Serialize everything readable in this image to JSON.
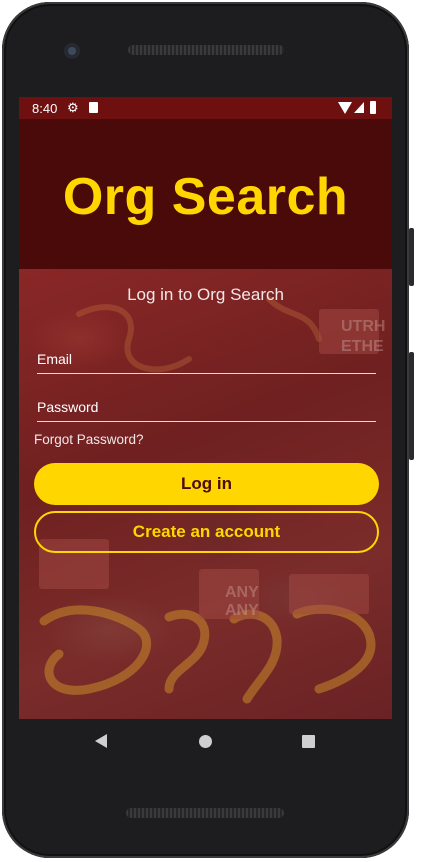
{
  "status_bar": {
    "time": "8:40",
    "icons": [
      "gear-icon",
      "sd-card-icon",
      "wifi-icon",
      "signal-icon",
      "battery-icon"
    ]
  },
  "app": {
    "title": "Org Search",
    "subtitle": "Log in to Org Search"
  },
  "form": {
    "email_placeholder": "Email",
    "password_placeholder": "Password",
    "forgot_label": "Forgot Password?",
    "login_label": "Log in",
    "create_label": "Create an account"
  },
  "nav": {
    "icons": [
      "back-icon",
      "home-icon",
      "recents-icon"
    ]
  },
  "colors": {
    "accent": "#ffd600",
    "status_bar": "#6e1010",
    "header": "#4b0a0a"
  }
}
